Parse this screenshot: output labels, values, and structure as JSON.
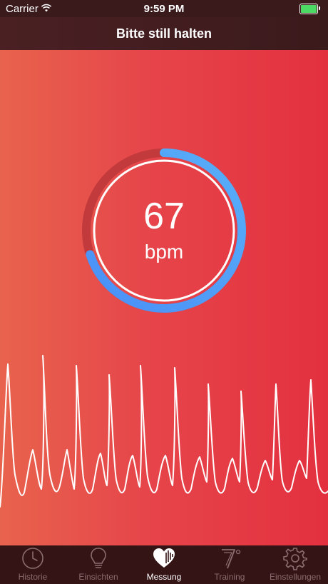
{
  "status_bar": {
    "carrier": "Carrier",
    "time": "9:59 PM",
    "battery_color": "#4cd964"
  },
  "nav": {
    "title": "Bitte still halten"
  },
  "measurement": {
    "value": "67",
    "unit": "bpm",
    "progress": 0.7,
    "ring_track_color": "#c23a3c",
    "ring_progress_color": "#3f8cf5"
  },
  "tabs": [
    {
      "label": "Historie",
      "icon": "clock-icon",
      "active": false
    },
    {
      "label": "Einsichten",
      "icon": "lightbulb-icon",
      "active": false
    },
    {
      "label": "Messung",
      "icon": "heart-icon",
      "active": true
    },
    {
      "label": "Training",
      "icon": "seven-icon",
      "active": false
    },
    {
      "label": "Einstellungen",
      "icon": "gear-icon",
      "active": false
    }
  ]
}
